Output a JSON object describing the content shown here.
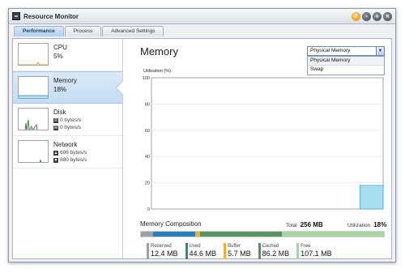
{
  "window": {
    "title": "Resource Monitor"
  },
  "window_buttons": [
    "?",
    "-",
    "+",
    "×"
  ],
  "tabs": [
    {
      "label": "Performance",
      "active": true
    },
    {
      "label": "Process",
      "active": false
    },
    {
      "label": "Advanced Settings",
      "active": false
    }
  ],
  "sidebar": {
    "items": [
      {
        "name": "CPU",
        "value": "5%",
        "icon": "cpu-graph-icon"
      },
      {
        "name": "Memory",
        "value": "18%",
        "icon": "memory-graph-icon"
      },
      {
        "name": "Disk",
        "read": "0 bytes/s",
        "write": "0 bytes/s",
        "icon": "disk-graph-icon"
      },
      {
        "name": "Network",
        "up": "696 bytes/s",
        "down": "880 bytes/s",
        "icon": "network-graph-icon"
      }
    ]
  },
  "main": {
    "title": "Memory",
    "select": {
      "value": "Physical Memory",
      "options": [
        "Physical Memory",
        "Swap"
      ]
    },
    "y_axis_label": "Utilization (%)"
  },
  "chart_data": {
    "type": "area",
    "title": "",
    "xlabel": "",
    "ylabel": "Utilization (%)",
    "ylim": [
      0,
      100
    ],
    "yticks": [
      0,
      20,
      40,
      60,
      80,
      100
    ],
    "x": [
      0,
      1,
      2,
      3,
      4,
      5,
      6,
      7,
      8,
      9,
      10
    ],
    "series": [
      {
        "values": [
          null,
          null,
          null,
          null,
          null,
          null,
          null,
          null,
          null,
          18,
          18
        ]
      }
    ],
    "grid": true,
    "color": "#a8dcef"
  },
  "composition": {
    "title": "Memory Composition",
    "total_label": "Total",
    "total_value": "256 MB",
    "util_label": "Utilization",
    "util_value": "18%",
    "segments": [
      {
        "label": "Reserved",
        "value": "12.4 MB",
        "mb": 12.4,
        "color": "#9aa1a8"
      },
      {
        "label": "Used",
        "value": "44.6 MB",
        "mb": 44.6,
        "color": "#2e7fb8"
      },
      {
        "label": "Buffer",
        "value": "5.7 MB",
        "mb": 5.7,
        "color": "#e6b43c"
      },
      {
        "label": "Cached",
        "value": "86.2 MB",
        "mb": 86.2,
        "color": "#5a9160"
      },
      {
        "label": "Free",
        "value": "107.1 MB",
        "mb": 107.1,
        "color": "#a9d3a2"
      }
    ]
  }
}
